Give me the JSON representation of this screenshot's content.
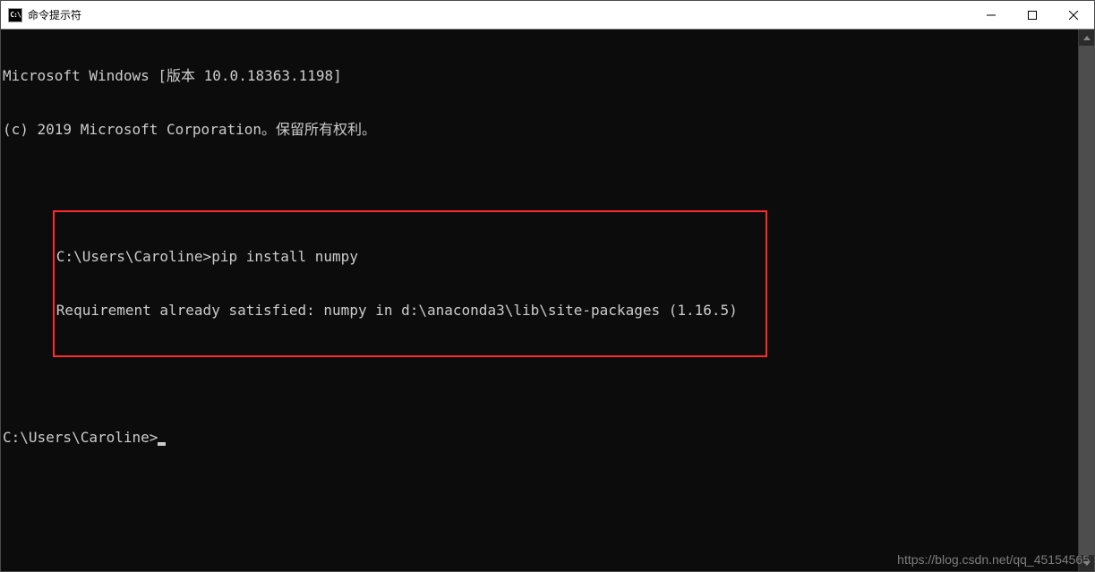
{
  "window": {
    "title": "命令提示符",
    "icon_label": "C:\\"
  },
  "terminal": {
    "line1": "Microsoft Windows [版本 10.0.18363.1198]",
    "line2": "(c) 2019 Microsoft Corporation。保留所有权利。",
    "blank1": "",
    "highlighted": {
      "line1": "C:\\Users\\Caroline>pip install numpy",
      "line2": "Requirement already satisfied: numpy in d:\\anaconda3\\lib\\site-packages (1.16.5)"
    },
    "blank2": "",
    "prompt": "C:\\Users\\Caroline>"
  },
  "watermark": "https://blog.csdn.net/qq_45154565"
}
